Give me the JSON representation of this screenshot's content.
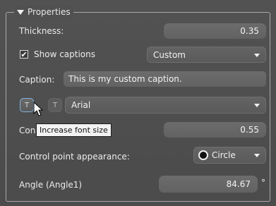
{
  "section": {
    "title": "Properties"
  },
  "thickness": {
    "label": "Thickness:",
    "value": "0.35"
  },
  "show_captions": {
    "label": "Show captions",
    "checked": true,
    "mode": "Custom"
  },
  "caption": {
    "label": "Caption:",
    "value": "This is my custom caption."
  },
  "font": {
    "button_increase": "T",
    "button_decrease": "T",
    "family": "Arial",
    "tooltip": "Increase font size"
  },
  "control_row": {
    "label_visible": "Con",
    "value": "0.55"
  },
  "control_point": {
    "label": "Control point appearance:",
    "value": "Circle"
  },
  "angle": {
    "label": "Angle (Angle1)",
    "value": "84.67",
    "unit": "°"
  },
  "colors": {
    "panel": "#4e4e4e",
    "field": "#666666",
    "tooltip_bg": "#f2f2f2",
    "focus": "#6aa6d8"
  }
}
